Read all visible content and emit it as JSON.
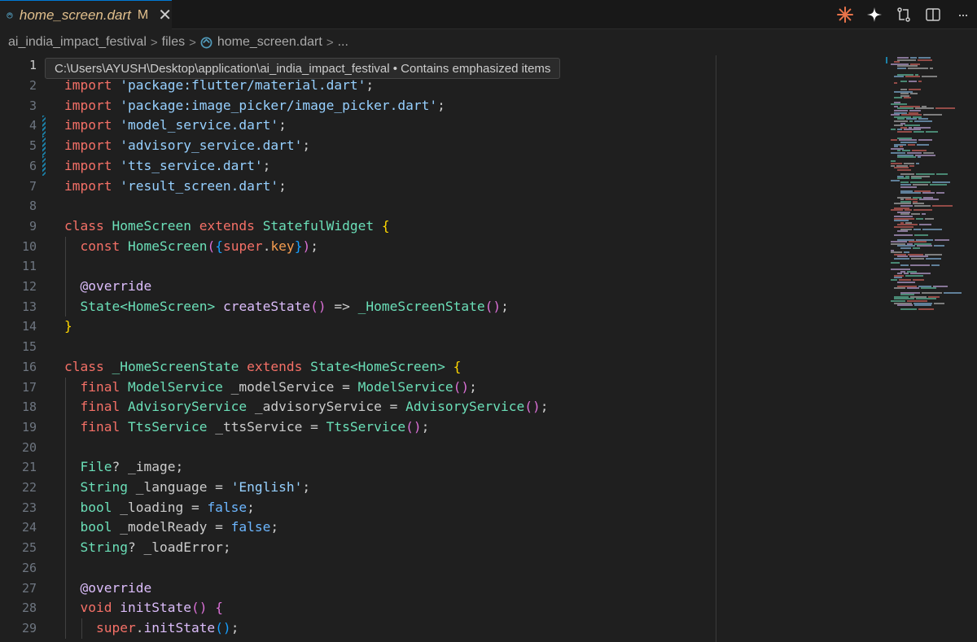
{
  "tab": {
    "title": "home_screen.dart",
    "modified": "M",
    "close": "✕"
  },
  "actions": [
    "spark-icon",
    "sparkle-icon",
    "compare-icon",
    "split-editor-icon",
    "more-icon"
  ],
  "more_label": "···",
  "breadcrumb": {
    "project": "ai_india_impact_festival",
    "folder": "files",
    "file": "home_screen.dart",
    "ellipsis": "..."
  },
  "tooltip": {
    "text": "C:\\Users\\AYUSH\\Desktop\\application\\ai_india_impact_festival • Contains emphasized items"
  },
  "editor": {
    "active_line": 1,
    "lines": [
      {
        "n": "1",
        "tokens": []
      },
      {
        "n": "2",
        "tokens": [
          {
            "t": "import",
            "c": "k-import"
          },
          {
            "t": " ",
            "c": "k-plain"
          },
          {
            "t": "'package:flutter/material.dart'",
            "c": "k-str"
          },
          {
            "t": ";",
            "c": "k-plain"
          }
        ]
      },
      {
        "n": "3",
        "tokens": [
          {
            "t": "import",
            "c": "k-import"
          },
          {
            "t": " ",
            "c": "k-plain"
          },
          {
            "t": "'package:image_picker/image_picker.dart'",
            "c": "k-str"
          },
          {
            "t": ";",
            "c": "k-plain"
          }
        ]
      },
      {
        "n": "4",
        "tokens": [
          {
            "t": "import",
            "c": "k-import"
          },
          {
            "t": " ",
            "c": "k-plain"
          },
          {
            "t": "'model_service.dart'",
            "c": "k-str"
          },
          {
            "t": ";",
            "c": "k-plain"
          }
        ]
      },
      {
        "n": "5",
        "tokens": [
          {
            "t": "import",
            "c": "k-import"
          },
          {
            "t": " ",
            "c": "k-plain"
          },
          {
            "t": "'advisory_service.dart'",
            "c": "k-str"
          },
          {
            "t": ";",
            "c": "k-plain"
          }
        ]
      },
      {
        "n": "6",
        "tokens": [
          {
            "t": "import",
            "c": "k-import"
          },
          {
            "t": " ",
            "c": "k-plain"
          },
          {
            "t": "'tts_service.dart'",
            "c": "k-str"
          },
          {
            "t": ";",
            "c": "k-plain"
          }
        ]
      },
      {
        "n": "7",
        "tokens": [
          {
            "t": "import",
            "c": "k-import"
          },
          {
            "t": " ",
            "c": "k-plain"
          },
          {
            "t": "'result_screen.dart'",
            "c": "k-str"
          },
          {
            "t": ";",
            "c": "k-plain"
          }
        ]
      },
      {
        "n": "8",
        "tokens": []
      },
      {
        "n": "9",
        "tokens": [
          {
            "t": "class",
            "c": "k-kw"
          },
          {
            "t": " ",
            "c": "k-plain"
          },
          {
            "t": "HomeScreen",
            "c": "k-type"
          },
          {
            "t": " ",
            "c": "k-plain"
          },
          {
            "t": "extends",
            "c": "k-kw"
          },
          {
            "t": " ",
            "c": "k-plain"
          },
          {
            "t": "StatefulWidget",
            "c": "k-type"
          },
          {
            "t": " ",
            "c": "k-plain"
          },
          {
            "t": "{",
            "c": "k-yellow"
          }
        ]
      },
      {
        "n": "10",
        "tokens": [
          {
            "t": "  ",
            "c": "k-plain"
          },
          {
            "t": "const",
            "c": "k-kw"
          },
          {
            "t": " ",
            "c": "k-plain"
          },
          {
            "t": "HomeScreen",
            "c": "k-type"
          },
          {
            "t": "(",
            "c": "k-pink"
          },
          {
            "t": "{",
            "c": "k-blue"
          },
          {
            "t": "super",
            "c": "k-kw"
          },
          {
            "t": ".",
            "c": "k-plain"
          },
          {
            "t": "key",
            "c": "k-orange"
          },
          {
            "t": "}",
            "c": "k-blue"
          },
          {
            "t": ")",
            "c": "k-pink"
          },
          {
            "t": ";",
            "c": "k-plain"
          }
        ]
      },
      {
        "n": "11",
        "tokens": []
      },
      {
        "n": "12",
        "tokens": [
          {
            "t": "  ",
            "c": "k-plain"
          },
          {
            "t": "@override",
            "c": "k-meta"
          }
        ]
      },
      {
        "n": "13",
        "tokens": [
          {
            "t": "  ",
            "c": "k-plain"
          },
          {
            "t": "State",
            "c": "k-type"
          },
          {
            "t": "<",
            "c": "k-type"
          },
          {
            "t": "HomeScreen",
            "c": "k-type"
          },
          {
            "t": ">",
            "c": "k-type"
          },
          {
            "t": " ",
            "c": "k-plain"
          },
          {
            "t": "createState",
            "c": "k-fn"
          },
          {
            "t": "()",
            "c": "k-pink"
          },
          {
            "t": " => ",
            "c": "k-plain"
          },
          {
            "t": "_HomeScreenState",
            "c": "k-type"
          },
          {
            "t": "()",
            "c": "k-pink"
          },
          {
            "t": ";",
            "c": "k-plain"
          }
        ]
      },
      {
        "n": "14",
        "tokens": [
          {
            "t": "}",
            "c": "k-yellow"
          }
        ]
      },
      {
        "n": "15",
        "tokens": []
      },
      {
        "n": "16",
        "tokens": [
          {
            "t": "class",
            "c": "k-kw"
          },
          {
            "t": " ",
            "c": "k-plain"
          },
          {
            "t": "_HomeScreenState",
            "c": "k-type"
          },
          {
            "t": " ",
            "c": "k-plain"
          },
          {
            "t": "extends",
            "c": "k-kw"
          },
          {
            "t": " ",
            "c": "k-plain"
          },
          {
            "t": "State",
            "c": "k-type"
          },
          {
            "t": "<",
            "c": "k-type"
          },
          {
            "t": "HomeScreen",
            "c": "k-type"
          },
          {
            "t": ">",
            "c": "k-type"
          },
          {
            "t": " ",
            "c": "k-plain"
          },
          {
            "t": "{",
            "c": "k-yellow"
          }
        ]
      },
      {
        "n": "17",
        "tokens": [
          {
            "t": "  ",
            "c": "k-plain"
          },
          {
            "t": "final",
            "c": "k-kw"
          },
          {
            "t": " ",
            "c": "k-plain"
          },
          {
            "t": "ModelService",
            "c": "k-type"
          },
          {
            "t": " _modelService = ",
            "c": "k-plain"
          },
          {
            "t": "ModelService",
            "c": "k-type"
          },
          {
            "t": "()",
            "c": "k-pink"
          },
          {
            "t": ";",
            "c": "k-plain"
          }
        ]
      },
      {
        "n": "18",
        "tokens": [
          {
            "t": "  ",
            "c": "k-plain"
          },
          {
            "t": "final",
            "c": "k-kw"
          },
          {
            "t": " ",
            "c": "k-plain"
          },
          {
            "t": "AdvisoryService",
            "c": "k-type"
          },
          {
            "t": " _advisoryService = ",
            "c": "k-plain"
          },
          {
            "t": "AdvisoryService",
            "c": "k-type"
          },
          {
            "t": "()",
            "c": "k-pink"
          },
          {
            "t": ";",
            "c": "k-plain"
          }
        ]
      },
      {
        "n": "19",
        "tokens": [
          {
            "t": "  ",
            "c": "k-plain"
          },
          {
            "t": "final",
            "c": "k-kw"
          },
          {
            "t": " ",
            "c": "k-plain"
          },
          {
            "t": "TtsService",
            "c": "k-type"
          },
          {
            "t": " _ttsService = ",
            "c": "k-plain"
          },
          {
            "t": "TtsService",
            "c": "k-type"
          },
          {
            "t": "()",
            "c": "k-pink"
          },
          {
            "t": ";",
            "c": "k-plain"
          }
        ]
      },
      {
        "n": "20",
        "tokens": []
      },
      {
        "n": "21",
        "tokens": [
          {
            "t": "  ",
            "c": "k-plain"
          },
          {
            "t": "File",
            "c": "k-type"
          },
          {
            "t": "? _image;",
            "c": "k-plain"
          }
        ]
      },
      {
        "n": "22",
        "tokens": [
          {
            "t": "  ",
            "c": "k-plain"
          },
          {
            "t": "String",
            "c": "k-type"
          },
          {
            "t": " _language = ",
            "c": "k-plain"
          },
          {
            "t": "'English'",
            "c": "k-str"
          },
          {
            "t": ";",
            "c": "k-plain"
          }
        ]
      },
      {
        "n": "23",
        "tokens": [
          {
            "t": "  ",
            "c": "k-plain"
          },
          {
            "t": "bool",
            "c": "k-type"
          },
          {
            "t": " _loading = ",
            "c": "k-plain"
          },
          {
            "t": "false",
            "c": "k-bool"
          },
          {
            "t": ";",
            "c": "k-plain"
          }
        ]
      },
      {
        "n": "24",
        "tokens": [
          {
            "t": "  ",
            "c": "k-plain"
          },
          {
            "t": "bool",
            "c": "k-type"
          },
          {
            "t": " _modelReady = ",
            "c": "k-plain"
          },
          {
            "t": "false",
            "c": "k-bool"
          },
          {
            "t": ";",
            "c": "k-plain"
          }
        ]
      },
      {
        "n": "25",
        "tokens": [
          {
            "t": "  ",
            "c": "k-plain"
          },
          {
            "t": "String",
            "c": "k-type"
          },
          {
            "t": "? _loadError;",
            "c": "k-plain"
          }
        ]
      },
      {
        "n": "26",
        "tokens": []
      },
      {
        "n": "27",
        "tokens": [
          {
            "t": "  ",
            "c": "k-plain"
          },
          {
            "t": "@override",
            "c": "k-meta"
          }
        ]
      },
      {
        "n": "28",
        "tokens": [
          {
            "t": "  ",
            "c": "k-plain"
          },
          {
            "t": "void",
            "c": "k-kw"
          },
          {
            "t": " ",
            "c": "k-plain"
          },
          {
            "t": "initState",
            "c": "k-fn"
          },
          {
            "t": "()",
            "c": "k-pink"
          },
          {
            "t": " ",
            "c": "k-plain"
          },
          {
            "t": "{",
            "c": "k-pink"
          }
        ]
      },
      {
        "n": "29",
        "tokens": [
          {
            "t": "    ",
            "c": "k-plain"
          },
          {
            "t": "super",
            "c": "k-kw"
          },
          {
            "t": ".",
            "c": "k-plain"
          },
          {
            "t": "initState",
            "c": "k-fn"
          },
          {
            "t": "()",
            "c": "k-blue"
          },
          {
            "t": ";",
            "c": "k-plain"
          }
        ]
      }
    ]
  },
  "colors": {
    "background": "#1f1f1f",
    "tab_modified": "#e2c08d",
    "dirty_marker": "#1b81a8",
    "accent": "#0078d4"
  }
}
